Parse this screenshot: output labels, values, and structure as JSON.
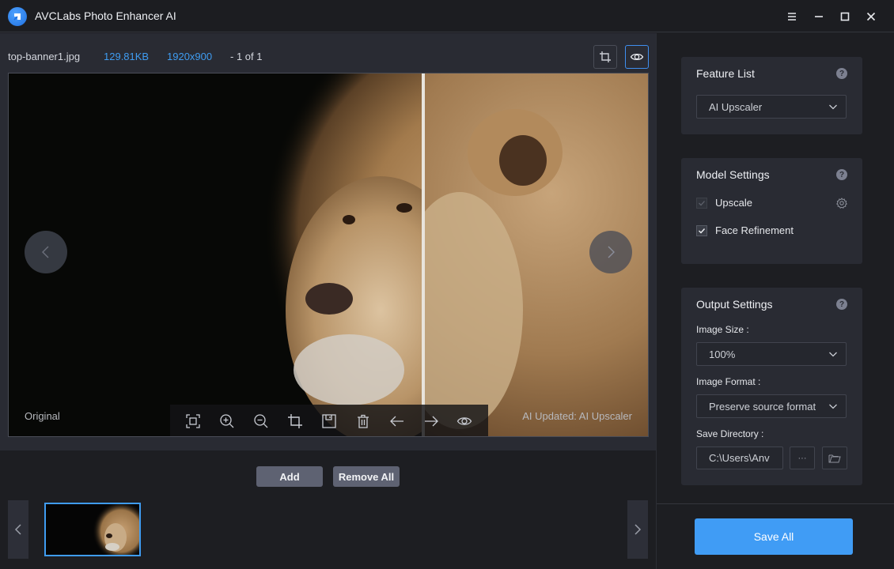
{
  "app": {
    "title": "AVCLabs Photo Enhancer AI",
    "window_controls": [
      "menu-icon",
      "minimize-icon",
      "maximize-icon",
      "close-icon"
    ]
  },
  "viewer": {
    "file_name": "top-banner1.jpg",
    "file_size": "129.81KB",
    "dimensions": "1920x900",
    "count": "- 1 of 1",
    "top_tools": [
      {
        "icon": "crop-icon",
        "active": false
      },
      {
        "icon": "eye-icon",
        "active": true
      }
    ],
    "label_original": "Original",
    "label_updated": "AI Updated: AI Upscaler",
    "toolbar": [
      "fit-screen-icon",
      "zoom-in-icon",
      "zoom-out-icon",
      "crop-icon",
      "save-icon",
      "trash-icon",
      "arrow-left-icon",
      "arrow-right-icon",
      "eye-icon"
    ],
    "prev_icon": "chevron-left-icon",
    "next_icon": "chevron-right-icon"
  },
  "bottom": {
    "add_label": "Add",
    "remove_all_label": "Remove All",
    "thumbnails": [
      {
        "name": "top-banner1.jpg",
        "selected": true
      }
    ]
  },
  "feature_list": {
    "title": "Feature List",
    "help": "?",
    "selected": "AI Upscaler"
  },
  "model_settings": {
    "title": "Model Settings",
    "help": "?",
    "options": [
      {
        "label": "Upscale",
        "checked": true,
        "disabled": true,
        "has_settings": true
      },
      {
        "label": "Face Refinement",
        "checked": true,
        "disabled": false,
        "has_settings": false
      }
    ]
  },
  "output_settings": {
    "title": "Output Settings",
    "help": "?",
    "image_size_label": "Image Size :",
    "image_size": "100%",
    "image_format_label": "Image Format :",
    "image_format": "Preserve source format",
    "save_directory_label": "Save Directory :",
    "save_directory": "C:\\Users\\Anv",
    "browse_label": "···"
  },
  "save_all_label": "Save All",
  "colors": {
    "accent": "#409cf5",
    "link": "#3f9cf1",
    "panel": "#292b33",
    "background": "#1d1e22"
  }
}
